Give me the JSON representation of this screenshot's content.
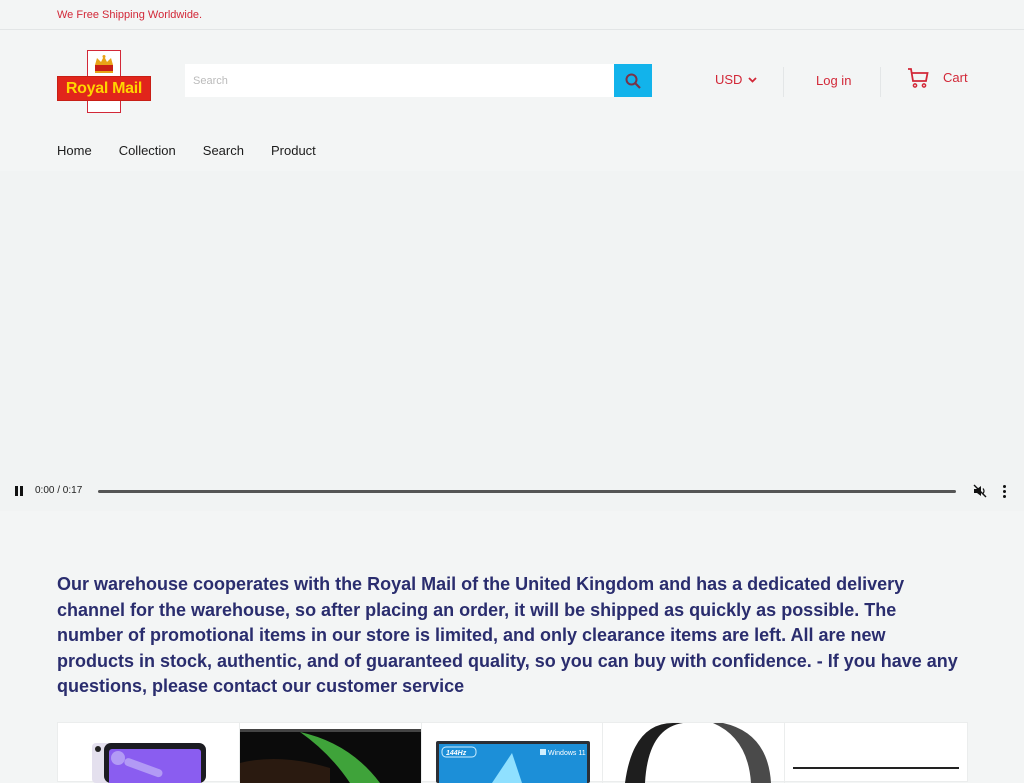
{
  "announcement": "We Free Shipping Worldwide.",
  "logo": {
    "text": "Royal Mail",
    "icon": "crown-icon"
  },
  "search": {
    "placeholder": "Search",
    "value": "",
    "button_icon": "search-icon"
  },
  "currency": {
    "selected": "USD",
    "icon": "chevron-down-icon"
  },
  "account": {
    "login_label": "Log in"
  },
  "cart": {
    "label": "Cart",
    "icon": "cart-icon"
  },
  "nav": {
    "items": [
      {
        "label": "Home"
      },
      {
        "label": "Collection"
      },
      {
        "label": "Search"
      },
      {
        "label": "Product"
      }
    ]
  },
  "video": {
    "time": "0:00 / 0:17",
    "progress": 0,
    "muted": true,
    "state": "playing"
  },
  "intro_text": "Our warehouse cooperates with the Royal Mail of the United Kingdom and has a dedicated delivery channel for the warehouse, so after placing an order, it will be shipped as quickly as possible. The number of promotional items in our store is limited, and only clearance items are left. All are new products in stock, authentic, and of guaranteed quality, so you can buy with confidence. - If you have any questions, please contact our customer service",
  "products": [
    {
      "name": "tablet-purple",
      "image": "tablet-image"
    },
    {
      "name": "laptop-green-screen",
      "image": "laptop-image"
    },
    {
      "name": "gaming-laptop",
      "image": "laptop-image",
      "badge": "144Hz",
      "os_label": "Windows 11"
    },
    {
      "name": "headphones",
      "image": "headphones-image"
    },
    {
      "name": "product-5",
      "image": "product-image"
    }
  ],
  "colors": {
    "accent": "#d22838",
    "search_button": "#12b3eb",
    "intro_text": "#2a2d6e",
    "logo_red": "#e1251b",
    "logo_yellow": "#ffd400"
  }
}
